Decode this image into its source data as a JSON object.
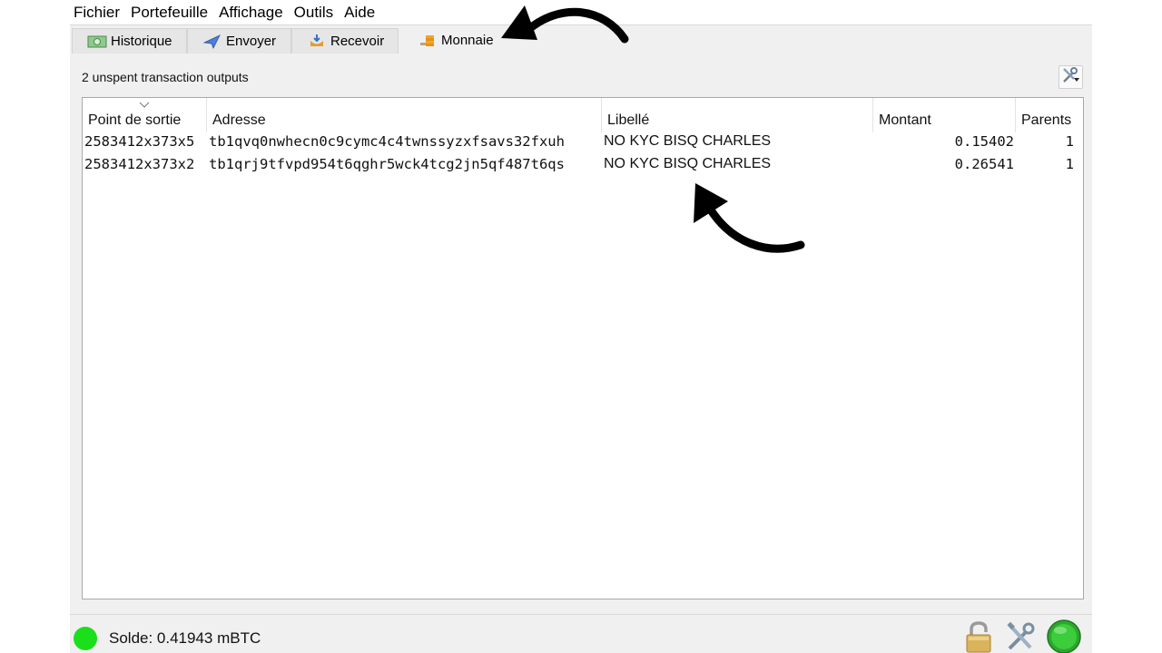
{
  "menu": [
    "Fichier",
    "Portefeuille",
    "Affichage",
    "Outils",
    "Aide"
  ],
  "tabs": [
    {
      "label": "Historique",
      "icon": "history-icon"
    },
    {
      "label": "Envoyer",
      "icon": "send-icon"
    },
    {
      "label": "Recevoir",
      "icon": "receive-icon"
    },
    {
      "label": "Monnaie",
      "icon": "coins-icon",
      "active": true
    }
  ],
  "summary": "2 unspent transaction outputs",
  "columns": [
    "Point de sortie",
    "Adresse",
    "Libellé",
    "Montant",
    "Parents"
  ],
  "rows": [
    {
      "outpoint": "2583412x373x5",
      "address": "tb1qvq0nwhecn0c9cymc4c4twnssyzxfsavs32fxuh",
      "label": "NO KYC BISQ CHARLES",
      "amount": "0.15402",
      "parents": "1"
    },
    {
      "outpoint": "2583412x373x2",
      "address": "tb1qrj9tfvpd954t6qghr5wck4tcg2jn5qf487t6qs",
      "label": "NO KYC BISQ CHARLES",
      "amount": "0.26541",
      "parents": "1"
    }
  ],
  "status": {
    "balance": "Solde: 0.41943 mBTC",
    "indicator_color": "#1adf1a",
    "icons": [
      "lock-icon",
      "preferences-icon",
      "network-status-icon"
    ]
  }
}
